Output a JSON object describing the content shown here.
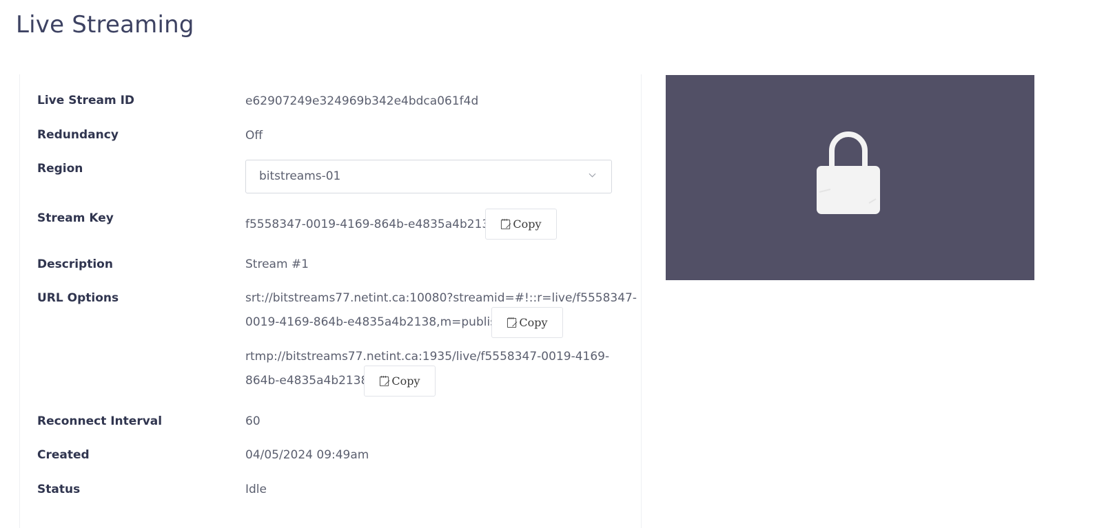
{
  "page": {
    "title": "Live Streaming"
  },
  "details": {
    "live_stream_id": {
      "label": "Live Stream ID",
      "value": "e62907249e324969b342e4bdca061f4d"
    },
    "redundancy": {
      "label": "Redundancy",
      "value": "Off"
    },
    "region": {
      "label": "Region",
      "selected": "bitstreams-01"
    },
    "stream_key": {
      "label": "Stream Key",
      "value": "f5558347-0019-4169-864b-e4835a4b2138",
      "copy_label": "Copy"
    },
    "description": {
      "label": "Description",
      "value": "Stream #1"
    },
    "url_options": {
      "label": "URL Options",
      "srt": {
        "line1": "srt://bitstreams77.netint.ca:10080?streamid=#!::r=live/f5558347-",
        "line2": "0019-4169-864b-e4835a4b2138,m=publish",
        "copy_label": "Copy"
      },
      "rtmp": {
        "line1": "rtmp://bitstreams77.netint.ca:1935/live/f5558347-0019-4169-",
        "line2": "864b-e4835a4b2138",
        "copy_label": "Copy"
      }
    },
    "reconnect_interval": {
      "label": "Reconnect Interval",
      "value": "60"
    },
    "created": {
      "label": "Created",
      "value": "04/05/2024 09:49am"
    },
    "status": {
      "label": "Status",
      "value": "Idle"
    }
  },
  "preview": {
    "icon": "lock-icon",
    "background": "#525066"
  }
}
